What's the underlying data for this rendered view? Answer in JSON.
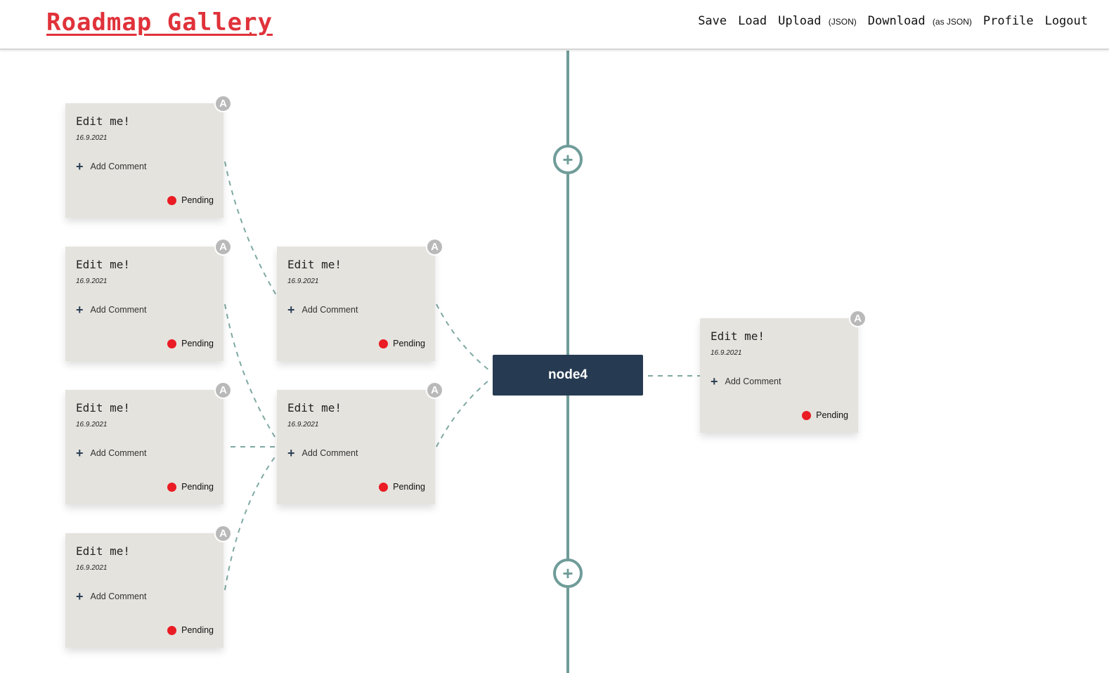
{
  "header": {
    "logo": "Roadmap Gallery",
    "nav": [
      {
        "label": "Save",
        "suffix": ""
      },
      {
        "label": "Load",
        "suffix": ""
      },
      {
        "label": "Upload",
        "suffix": "(JSON)"
      },
      {
        "label": "Download",
        "suffix": "(as JSON)"
      },
      {
        "label": "Profile",
        "suffix": ""
      },
      {
        "label": "Logout",
        "suffix": ""
      }
    ]
  },
  "central_node": {
    "label": "node4"
  },
  "cards": [
    {
      "title": "Edit me!",
      "date": "16.9.2021",
      "add_comment": "Add Comment",
      "status": "Pending",
      "avatar": "A"
    },
    {
      "title": "Edit me!",
      "date": "16.9.2021",
      "add_comment": "Add Comment",
      "status": "Pending",
      "avatar": "A"
    },
    {
      "title": "Edit me!",
      "date": "16.9.2021",
      "add_comment": "Add Comment",
      "status": "Pending",
      "avatar": "A"
    },
    {
      "title": "Edit me!",
      "date": "16.9.2021",
      "add_comment": "Add Comment",
      "status": "Pending",
      "avatar": "A"
    },
    {
      "title": "Edit me!",
      "date": "16.9.2021",
      "add_comment": "Add Comment",
      "status": "Pending",
      "avatar": "A"
    },
    {
      "title": "Edit me!",
      "date": "16.9.2021",
      "add_comment": "Add Comment",
      "status": "Pending",
      "avatar": "A"
    },
    {
      "title": "Edit me!",
      "date": "16.9.2021",
      "add_comment": "Add Comment",
      "status": "Pending",
      "avatar": "A"
    }
  ],
  "colors": {
    "logo": "#e0323a",
    "timeline": "#6f9c99",
    "node": "#263a52",
    "card": "#e5e3de",
    "pending": "#ea1c24"
  },
  "icons": {
    "add_comment": "plus-icon",
    "add_node": "plus-circle-icon",
    "status": "status-dot-icon",
    "avatar": "avatar-badge"
  }
}
